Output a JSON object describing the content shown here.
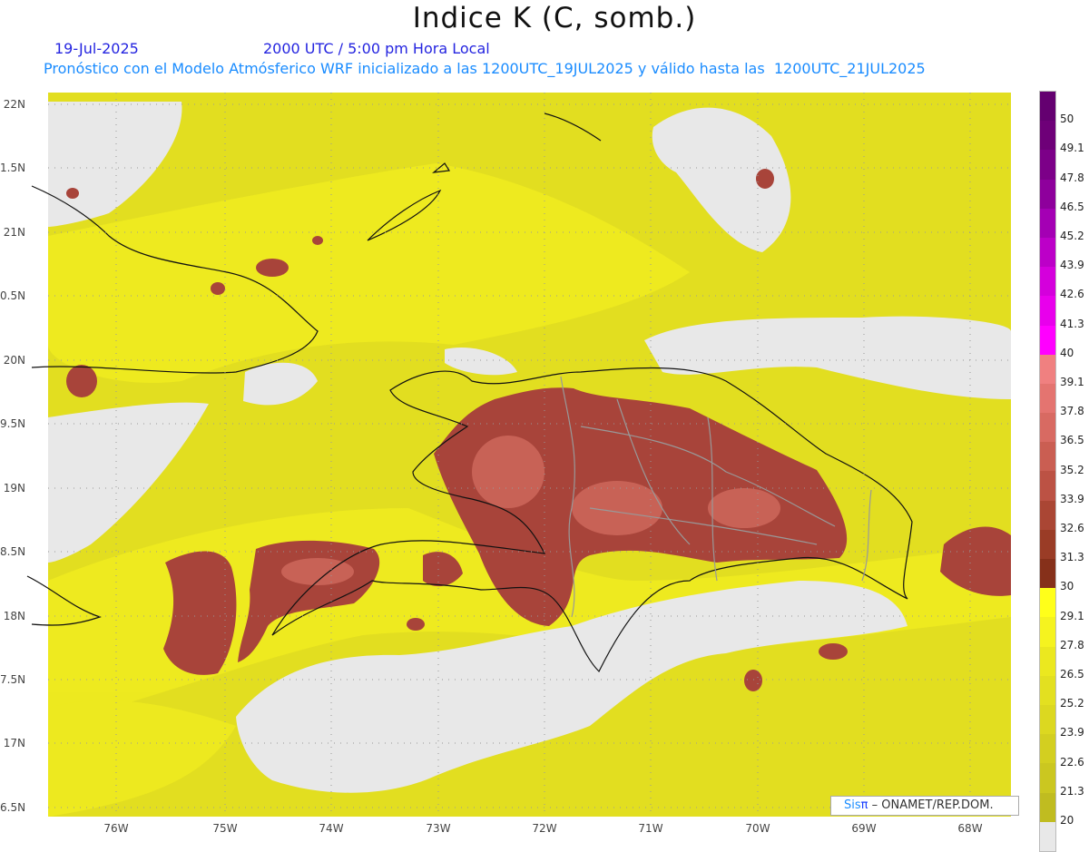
{
  "header": {
    "title": "Indice K (C, somb.)",
    "date": "19-Jul-2025",
    "time": "2000 UTC / 5:00 pm Hora Local",
    "description": "Pronóstico con el Modelo Atmósferico WRF inicializado a las 1200UTC_19JUL2025 y válido hasta las  1200UTC_21JUL2025"
  },
  "axes": {
    "lat_labels": [
      "22N",
      "1.5N",
      "21N",
      "0.5N",
      "20N",
      "9.5N",
      "19N",
      "8.5N",
      "18N",
      "7.5N",
      "17N",
      "6.5N"
    ],
    "lon_labels": [
      "76W",
      "75W",
      "74W",
      "73W",
      "72W",
      "71W",
      "70W",
      "69W",
      "68W"
    ]
  },
  "legend": {
    "labels": [
      "50",
      "49.1",
      "47.8",
      "46.5",
      "45.2",
      "43.9",
      "42.6",
      "41.3",
      "40",
      "39.1",
      "37.8",
      "36.5",
      "35.2",
      "33.9",
      "32.6",
      "31.3",
      "30",
      "29.1",
      "27.8",
      "26.5",
      "25.2",
      "23.9",
      "22.6",
      "21.3",
      "20"
    ],
    "colors": [
      "#640070",
      "#6e0078",
      "#7c0088",
      "#8e009c",
      "#a400b4",
      "#bc00c8",
      "#d400dc",
      "#e800ec",
      "#ff00ff",
      "#f08080",
      "#e47470",
      "#d86a62",
      "#ca5e52",
      "#bc5244",
      "#aa4634",
      "#9a3c26",
      "#86301a",
      "#ffff1a",
      "#f5f31f",
      "#ebe81f",
      "#e3e020",
      "#dcd820",
      "#d3cf20",
      "#cbc720",
      "#c0bc20",
      "#e8e8e8"
    ]
  },
  "credit": {
    "sis": "Sis",
    "pi": "π",
    "org": "– ONAMET/REP.DOM."
  },
  "map_colors": {
    "base": "#e2de20",
    "bright": "#f2ee1e",
    "low": "#e8e8e8",
    "high": "#a8443a",
    "peak": "#d06a5e"
  }
}
